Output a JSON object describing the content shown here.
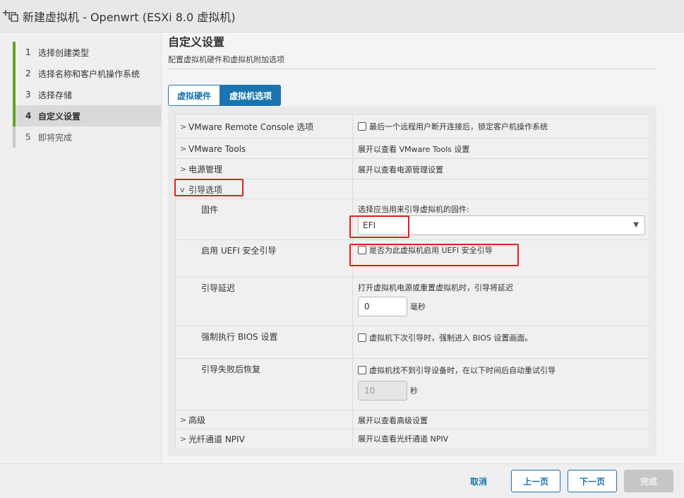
{
  "window": {
    "title": "新建虚拟机 - Openwrt (ESXi 8.0 虚拟机)",
    "icon": "new-vm-icon"
  },
  "steps": [
    {
      "num": "1",
      "label": "选择创建类型"
    },
    {
      "num": "2",
      "label": "选择名称和客户机操作系统"
    },
    {
      "num": "3",
      "label": "选择存储"
    },
    {
      "num": "4",
      "label": "自定义设置"
    },
    {
      "num": "5",
      "label": "即将完成"
    }
  ],
  "page": {
    "title": "自定义设置",
    "subtitle": "配置虚拟机硬件和虚拟机附加选项"
  },
  "tabs": {
    "hardware": "虚拟硬件",
    "options": "虚拟机选项"
  },
  "rows": {
    "vmrc": {
      "label": "VMware Remote Console 选项",
      "value": "最后一个远程用户断开连接后，锁定客户机操作系统"
    },
    "tools": {
      "label": "VMware Tools",
      "value": "展开以查看 VMware Tools 设置"
    },
    "power": {
      "label": "电源管理",
      "value": "展开以查看电源管理设置"
    },
    "boot": {
      "label": "引导选项"
    },
    "firmware": {
      "label": "固件",
      "hint": "选择应当用来引导虚拟机的固件:",
      "selected": "EFI"
    },
    "secure_boot": {
      "label": "启用 UEFI 安全引导",
      "value": "是否为此虚拟机启用 UEFI 安全引导"
    },
    "boot_delay": {
      "label": "引导延迟",
      "hint": "打开虚拟机电源或重置虚拟机时，引导将延迟",
      "value": "0",
      "unit": "毫秒"
    },
    "force_bios": {
      "label": "强制执行 BIOS 设置",
      "value": "虚拟机下次引导时，强制进入 BIOS 设置画面。"
    },
    "failed_boot": {
      "label": "引导失败后恢复",
      "value": "虚拟机找不到引导设备时，在以下时间后自动重试引导",
      "delay": "10",
      "unit": "秒"
    },
    "advanced": {
      "label": "高级",
      "value": "展开以查看高级设置"
    },
    "npiv": {
      "label": "光纤通道 NPIV",
      "value": "展开以查看光纤通道 NPIV"
    }
  },
  "footer": {
    "cancel": "取消",
    "back": "上一页",
    "next": "下一页",
    "finish": "完成"
  },
  "colors": {
    "accent": "#1a74b0",
    "step_done": "#62a420",
    "highlight": "#e02020"
  }
}
